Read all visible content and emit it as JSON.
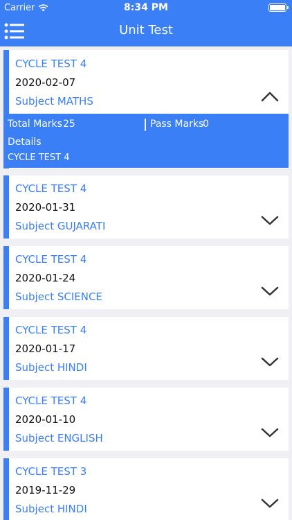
{
  "status_bar": {
    "carrier": "Carrier",
    "time": "8:34 PM"
  },
  "header": {
    "title": "Unit Test"
  },
  "cards": [
    {
      "test": "CYCLE TEST 4",
      "date": "2020-02-07",
      "subject": "Subject MATHS",
      "expanded": true,
      "details": {
        "total_marks_label": "Total Marks",
        "total_marks": "25",
        "pass_marks_label": "Pass Marks",
        "pass_marks": "0",
        "details_label": "Details",
        "details_value": "CYCLE TEST 4"
      }
    },
    {
      "test": "CYCLE TEST 4",
      "date": "2020-01-31",
      "subject": "Subject GUJARATI"
    },
    {
      "test": "CYCLE TEST 4",
      "date": "2020-01-24",
      "subject": "Subject SCIENCE"
    },
    {
      "test": "CYCLE TEST 4",
      "date": "2020-01-17",
      "subject": "Subject HINDI"
    },
    {
      "test": "CYCLE TEST 4",
      "date": "2020-01-10",
      "subject": "Subject ENGLISH"
    },
    {
      "test": "CYCLE TEST 3",
      "date": "2019-11-29",
      "subject": "Subject HINDI"
    }
  ],
  "colors": {
    "accent": "#3a7ff6",
    "background": "#efeff4"
  }
}
